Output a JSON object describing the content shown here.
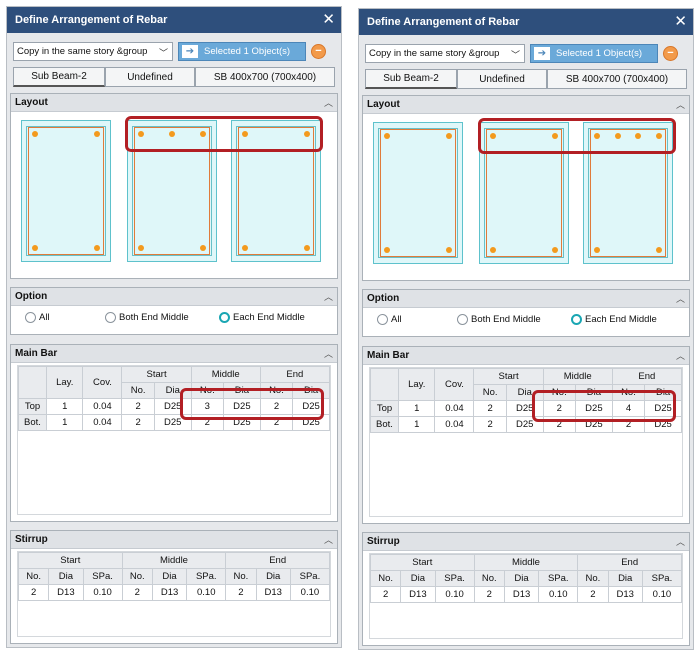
{
  "panels": [
    {
      "title": "Define Arrangement of Rebar",
      "copy_option": "Copy in the same story &group",
      "selected": "Selected 1 Object(s)",
      "tabs": [
        "Sub Beam-2",
        "Undefined",
        "SB 400x700 (700x400)"
      ],
      "sections": {
        "layout": "Layout",
        "option": "Option",
        "main_bar": "Main Bar",
        "stirrup": "Stirrup"
      },
      "options": [
        "All",
        "Both End Middle",
        "Each End Middle"
      ],
      "selected_option": "Each End Middle",
      "layout_top_bars": [
        2,
        3,
        2
      ],
      "main_bar": {
        "headers": {
          "lay": "Lay.",
          "cov": "Cov.",
          "start": "Start",
          "middle": "Middle",
          "end": "End",
          "no": "No.",
          "dia": "Dia"
        },
        "rows": [
          {
            "label": "Top",
            "lay": "1",
            "cov": "0.04",
            "start_no": "2",
            "start_dia": "D25",
            "mid_no": "3",
            "mid_dia": "D25",
            "end_no": "2",
            "end_dia": "D25"
          },
          {
            "label": "Bot.",
            "lay": "1",
            "cov": "0.04",
            "start_no": "2",
            "start_dia": "D25",
            "mid_no": "2",
            "mid_dia": "D25",
            "end_no": "2",
            "end_dia": "D25"
          }
        ]
      },
      "stirrup": {
        "headers": {
          "start": "Start",
          "middle": "Middle",
          "end": "End",
          "no": "No.",
          "dia": "Dia",
          "spa": "SPa."
        },
        "row": {
          "start_no": "2",
          "start_dia": "D13",
          "start_spa": "0.10",
          "mid_no": "2",
          "mid_dia": "D13",
          "mid_spa": "0.10",
          "end_no": "2",
          "end_dia": "D13",
          "end_spa": "0.10"
        }
      }
    },
    {
      "title": "Define Arrangement of Rebar",
      "copy_option": "Copy in the same story &group",
      "selected": "Selected 1 Object(s)",
      "tabs": [
        "Sub Beam-2",
        "Undefined",
        "SB 400x700 (700x400)"
      ],
      "sections": {
        "layout": "Layout",
        "option": "Option",
        "main_bar": "Main Bar",
        "stirrup": "Stirrup"
      },
      "options": [
        "All",
        "Both End Middle",
        "Each End Middle"
      ],
      "selected_option": "Each End Middle",
      "layout_top_bars": [
        2,
        2,
        4
      ],
      "main_bar": {
        "headers": {
          "lay": "Lay.",
          "cov": "Cov.",
          "start": "Start",
          "middle": "Middle",
          "end": "End",
          "no": "No.",
          "dia": "Dia"
        },
        "rows": [
          {
            "label": "Top",
            "lay": "1",
            "cov": "0.04",
            "start_no": "2",
            "start_dia": "D25",
            "mid_no": "2",
            "mid_dia": "D25",
            "end_no": "4",
            "end_dia": "D25"
          },
          {
            "label": "Bot.",
            "lay": "1",
            "cov": "0.04",
            "start_no": "2",
            "start_dia": "D25",
            "mid_no": "2",
            "mid_dia": "D25",
            "end_no": "2",
            "end_dia": "D25"
          }
        ]
      },
      "stirrup": {
        "headers": {
          "start": "Start",
          "middle": "Middle",
          "end": "End",
          "no": "No.",
          "dia": "Dia",
          "spa": "SPa."
        },
        "row": {
          "start_no": "2",
          "start_dia": "D13",
          "start_spa": "0.10",
          "mid_no": "2",
          "mid_dia": "D13",
          "mid_spa": "0.10",
          "end_no": "2",
          "end_dia": "D13",
          "end_spa": "0.10"
        }
      }
    }
  ],
  "colors": {
    "titlebar": "#2e4f7c",
    "highlight": "#b21f24",
    "rebar_dot": "#f39a1e",
    "stirrup": "#e07b3a",
    "section_fill": "#dff7f9"
  }
}
